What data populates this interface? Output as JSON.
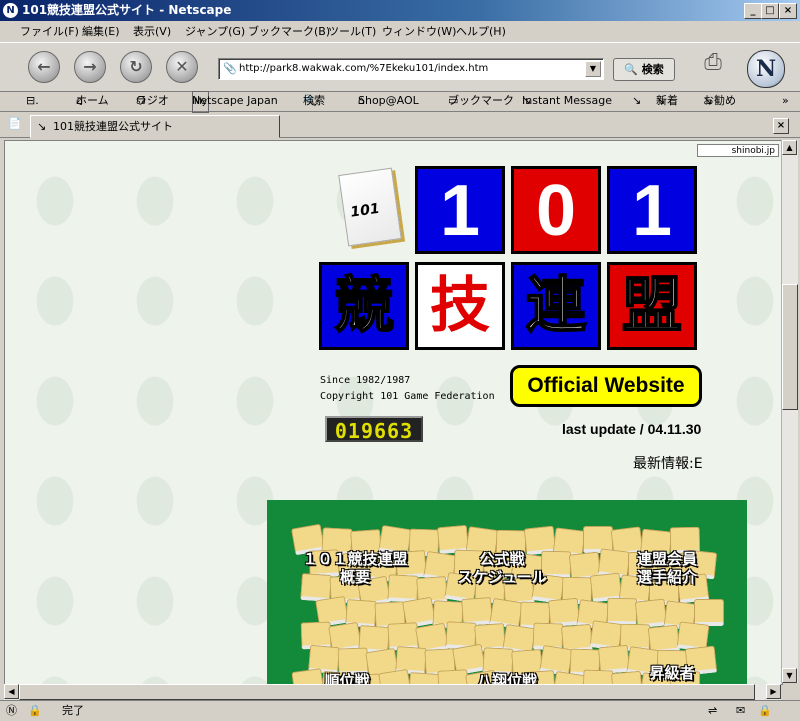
{
  "window": {
    "title": "101競技連盟公式サイト - Netscape",
    "app_icon": "N"
  },
  "menubar": [
    "ファイル(F)",
    "編集(E)",
    "表示(V)",
    "ジャンプ(G)",
    "ブックマーク(B)",
    "ツール(T)",
    "ウィンドウ(W)",
    "ヘルプ(H)"
  ],
  "navbar": {
    "url": "http://park8.wakwak.com/%7Ekeku101/index.htm",
    "search_label": "検索"
  },
  "personal_toolbar": [
    "ホーム",
    "ラジオ",
    "Netscape Japan",
    "検索",
    "Shop@AOL",
    "ブックマーク",
    "Instant Message",
    "新着",
    "お勧め",
    "»"
  ],
  "tab": {
    "label": "101競技連盟公式サイト"
  },
  "page": {
    "badge": "shinobi.jp",
    "tile_logo": "101",
    "grid_numbers": [
      "1",
      "0",
      "1"
    ],
    "grid_kanji": [
      "競",
      "技",
      "連",
      "盟"
    ],
    "official": "Official Website",
    "since": "Since 1982/1987",
    "copyright": "Copyright 101 Game Federation",
    "counter": "019663",
    "last_update": "last update / 04.11.30",
    "news": "最新情報:E",
    "menu": {
      "overview": "１０１競技連盟\n概要",
      "schedule": "公式戦\nスケジュール",
      "members": "連盟会員\n選手紹介",
      "ranking": "順位戦",
      "hachigumi": "八翔位戦",
      "promoted": "昇級者"
    }
  },
  "status": {
    "text": "完了"
  },
  "colors": {
    "blue": "#0000e0",
    "red": "#e00000",
    "yellow": "#ffff00",
    "green": "#138a3a"
  }
}
